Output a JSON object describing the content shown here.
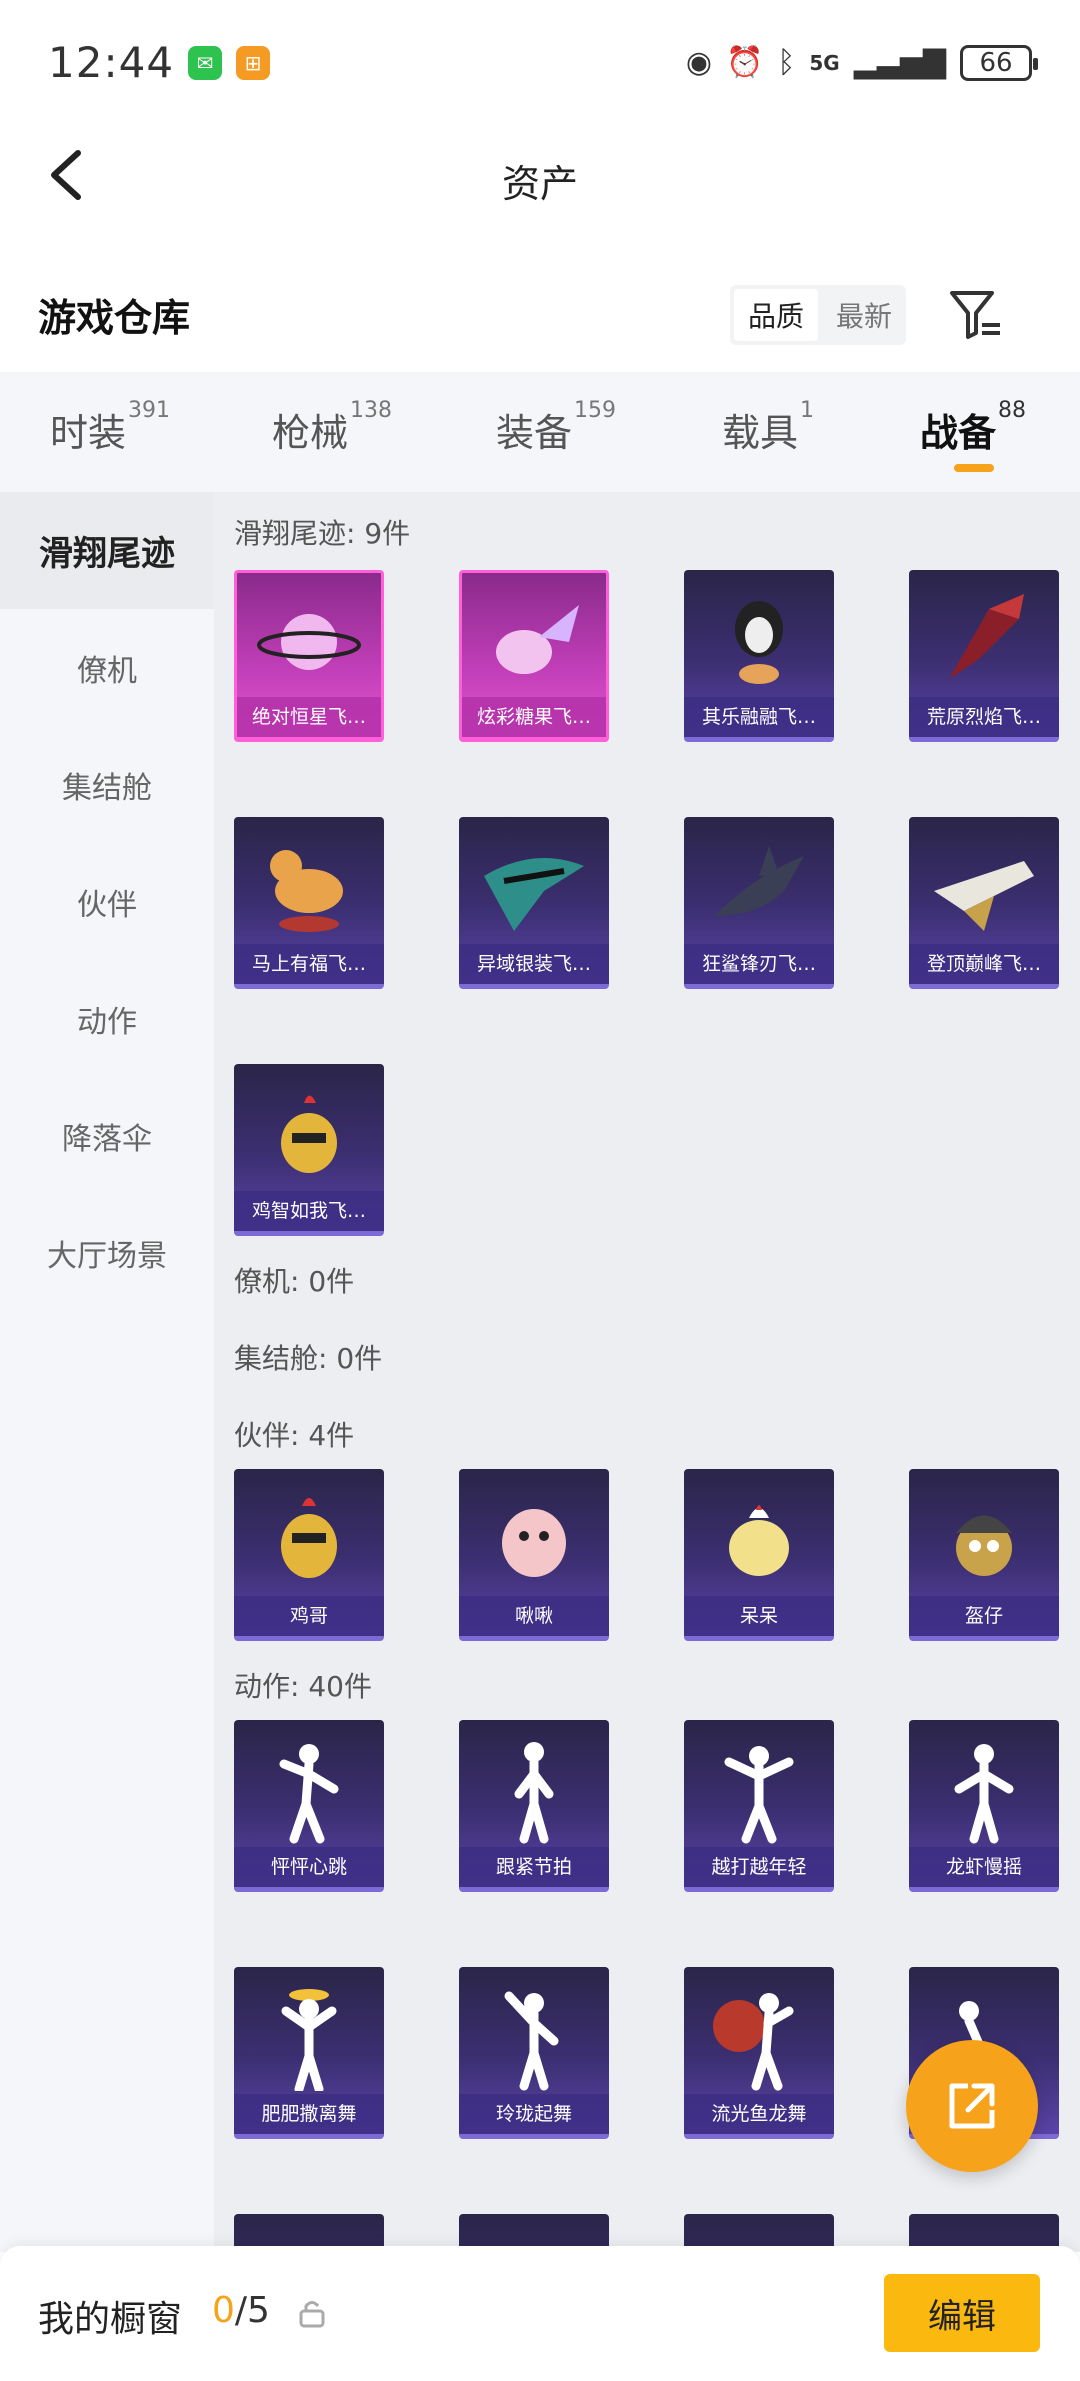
{
  "status_bar": {
    "time": "12:44",
    "battery": "66",
    "network": "5G"
  },
  "header": {
    "title": "资产"
  },
  "warehouse": {
    "title": "游戏仓库",
    "sort_options": [
      "品质",
      "最新"
    ]
  },
  "tabs": [
    {
      "label": "时装",
      "count": "391"
    },
    {
      "label": "枪械",
      "count": "138"
    },
    {
      "label": "装备",
      "count": "159"
    },
    {
      "label": "载具",
      "count": "1"
    },
    {
      "label": "战备",
      "count": "88"
    }
  ],
  "sidebar": {
    "items": [
      "滑翔尾迹",
      "僚机",
      "集结舱",
      "伙伴",
      "动作",
      "降落伞",
      "大厅场景"
    ]
  },
  "sections": {
    "glide": {
      "label": "滑翔尾迹: 9件",
      "items": [
        "绝对恒星飞…",
        "炫彩糖果飞…",
        "其乐融融飞…",
        "荒原烈焰飞…",
        "马上有福飞…",
        "异域银装飞…",
        "狂鲨锋刃飞…",
        "登顶巅峰飞…",
        "鸡智如我飞…"
      ]
    },
    "wingman": {
      "label": "僚机: 0件"
    },
    "pod": {
      "label": "集结舱: 0件"
    },
    "partner": {
      "label": "伙伴: 4件",
      "items": [
        "鸡哥",
        "啾啾",
        "呆呆",
        "盔仔"
      ]
    },
    "emote": {
      "label": "动作: 40件",
      "items": [
        "怦怦心跳",
        "跟紧节拍",
        "越打越年轻",
        "龙虾慢摇",
        "肥肥撒离舞",
        "玲珑起舞",
        "流光鱼龙舞"
      ]
    }
  },
  "bottom": {
    "showcase_label": "我的橱窗",
    "current": "0",
    "total": "/5",
    "edit_label": "编辑"
  },
  "colors": {
    "accent": "#f7a21b",
    "card_purple": "#3c2f72",
    "card_pink": "#c23fb8"
  }
}
